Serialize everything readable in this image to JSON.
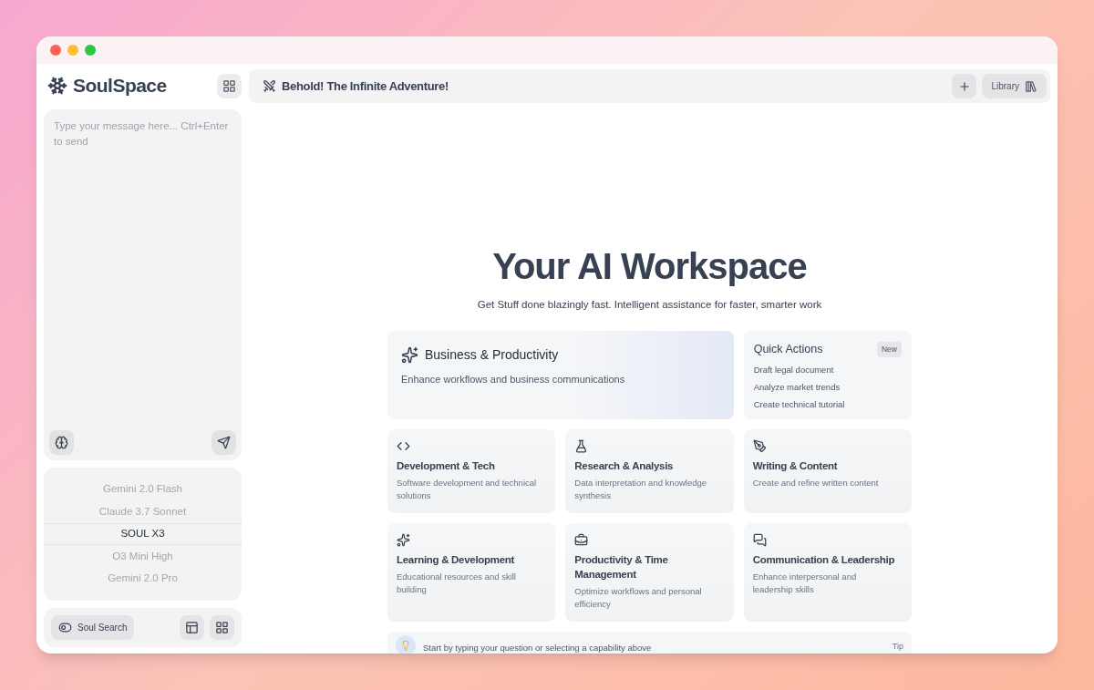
{
  "sidebar": {
    "brand": "SoulSpace",
    "composer": {
      "placeholder": "Type your message here... Ctrl+Enter to send"
    },
    "models": [
      {
        "name": "Gemini 2.0 Flash",
        "selected": false
      },
      {
        "name": "Claude 3.7 Sonnet",
        "selected": false
      },
      {
        "name": "SOUL X3",
        "selected": true
      },
      {
        "name": "O3 Mini High",
        "selected": false
      },
      {
        "name": "Gemini 2.0 Pro",
        "selected": false
      }
    ],
    "search_button": "Soul Search"
  },
  "header": {
    "title": "Behold! The Infinite Adventure!",
    "library_button": "Library"
  },
  "hero": {
    "title": "Your AI Workspace",
    "subtitle": "Get Stuff done blazingly fast. Intelligent assistance for faster, smarter work"
  },
  "featured": {
    "title": "Business & Productivity",
    "description": "Enhance workflows and business communications"
  },
  "quick_actions": {
    "title": "Quick Actions",
    "badge": "New",
    "items": [
      "Draft legal document",
      "Analyze market trends",
      "Create technical tutorial"
    ]
  },
  "capabilities": [
    {
      "title": "Development & Tech",
      "description": "Software development and technical solutions"
    },
    {
      "title": "Research & Analysis",
      "description": "Data interpretation and knowledge synthesis"
    },
    {
      "title": "Writing & Content",
      "description": "Create and refine written content"
    },
    {
      "title": "Learning & Development",
      "description": "Educational resources and skill building"
    },
    {
      "title": "Productivity & Time Management",
      "description": "Optimize workflows and personal efficiency"
    },
    {
      "title": "Communication & Leadership",
      "description": "Enhance interpersonal and leadership skills"
    }
  ],
  "tip": {
    "text": "Start by typing your question or selecting a capability above",
    "label": "Tip"
  }
}
